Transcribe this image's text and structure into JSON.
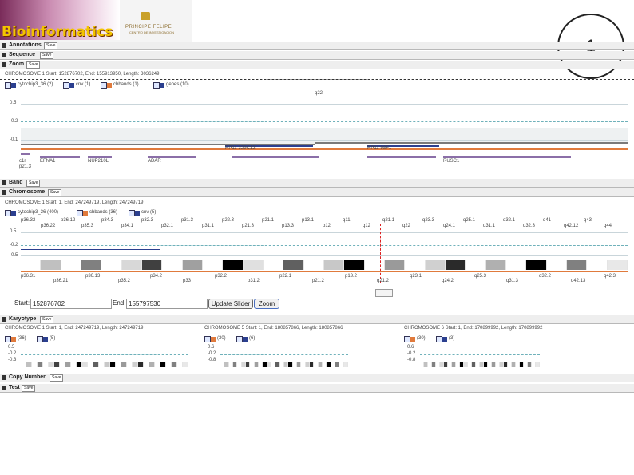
{
  "logo": {
    "text": "Bioinformatics",
    "institute": "PRINCIPE FELIPE",
    "institute_sub": "CENTRO DE INVESTIGACION"
  },
  "slide_number": "1",
  "sections": {
    "annotations": {
      "label": "Annotations",
      "btn": "Save"
    },
    "sequence": {
      "label": "Sequence",
      "btn": "Save"
    },
    "zoom": {
      "label": "Zoom",
      "btn": "Save"
    },
    "band": {
      "label": "Band",
      "btn": "Save"
    },
    "chromosome": {
      "label": "Chromosome",
      "btn": "Save"
    },
    "karyotype": {
      "label": "Karyotype",
      "btn": "Save"
    },
    "copy_number": {
      "label": "Copy Number",
      "btn": "Save"
    },
    "test": {
      "label": "Test",
      "btn": "Save"
    }
  },
  "zoom_panel": {
    "header": "CHROMOSOME 1  Start: 152876702, End: 155913950, Length: 3036249",
    "legend": [
      {
        "label": "cytochip3_36 (2)",
        "color": "#2b3f8f"
      },
      {
        "label": "cnv (1)",
        "color": "#2b3f8f"
      },
      {
        "label": "cbbands (1)",
        "color": "#e07a3c"
      },
      {
        "label": "genes (10)",
        "color": "#2b3f8f"
      }
    ],
    "band_label": "q22",
    "y_ticks": [
      "0.5",
      "-0.2",
      "-0.1"
    ],
    "labels": {
      "b1": "RP11-329C12",
      "b2": "RP11-98F1",
      "g1": "EFNA1",
      "g2": "NUP210L",
      "g3": "ADAR",
      "g4": "RUSC1",
      "g5": "KCNN3",
      "g6": "p21.3",
      "g7": "c1r"
    }
  },
  "chromosome_panel": {
    "header": "CHROMOSOME 1  Start: 1, End: 247249719, Length: 247249719",
    "legend": [
      {
        "label": "cytochip3_36 (400)",
        "color": "#2b3f8f"
      },
      {
        "label": "cbbands (36)",
        "color": "#e07a3c"
      },
      {
        "label": "cnv (5)",
        "color": "#2b3f8f"
      }
    ],
    "y_ticks": [
      "0.5",
      "-0.2",
      "-0.5"
    ],
    "top_labels": [
      "p36.32",
      "p36.22",
      "p36.12",
      "p35.3",
      "p34.3",
      "p34.1",
      "p32.3",
      "p32.1",
      "p31.3",
      "p31.1",
      "p22.3",
      "p21.3",
      "p21.1",
      "p13.3",
      "p13.1",
      "p12",
      "q11",
      "q12",
      "q21.1",
      "q22",
      "q23.3",
      "q24.1",
      "q25.1",
      "q31.1",
      "q32.1",
      "q32.3",
      "q41",
      "q42.12",
      "q43",
      "q44"
    ],
    "bottom_labels": [
      "p36.31",
      "p36.21",
      "p36.13",
      "p35.2",
      "p34.2",
      "p33",
      "p32.2",
      "p31.2",
      "p22.1",
      "p21.2",
      "p13.2",
      "q21.2",
      "q23.1",
      "q24.2",
      "q25.3",
      "q31.3",
      "q32.2",
      "q42.13",
      "q42.3"
    ],
    "start_label": "Start:",
    "start_value": "152876702",
    "end_label": "End:",
    "end_value": "155797530",
    "update_btn": "Update Slider",
    "zoom_btn": "Zoom"
  },
  "karyotype": [
    {
      "header": "CHROMOSOME 1  Start: 1, End: 247249719, Length: 247249719",
      "c1": "(36)",
      "c2": "(5)",
      "ticks": [
        "0.5",
        "-0.2",
        "-0.3"
      ]
    },
    {
      "header": "CHROMOSOME 5  Start: 1, End: 180857866, Length: 180857866",
      "c1": "(30)",
      "c2": "(6)",
      "ticks": [
        "0.6",
        "-0.2",
        "-0.8"
      ]
    },
    {
      "header": "CHROMOSOME 6  Start: 1, End: 170899992, Length: 170899992",
      "c1": "(30)",
      "c2": "(3)",
      "ticks": [
        "0.6",
        "-0.2",
        "-0.8"
      ]
    }
  ]
}
